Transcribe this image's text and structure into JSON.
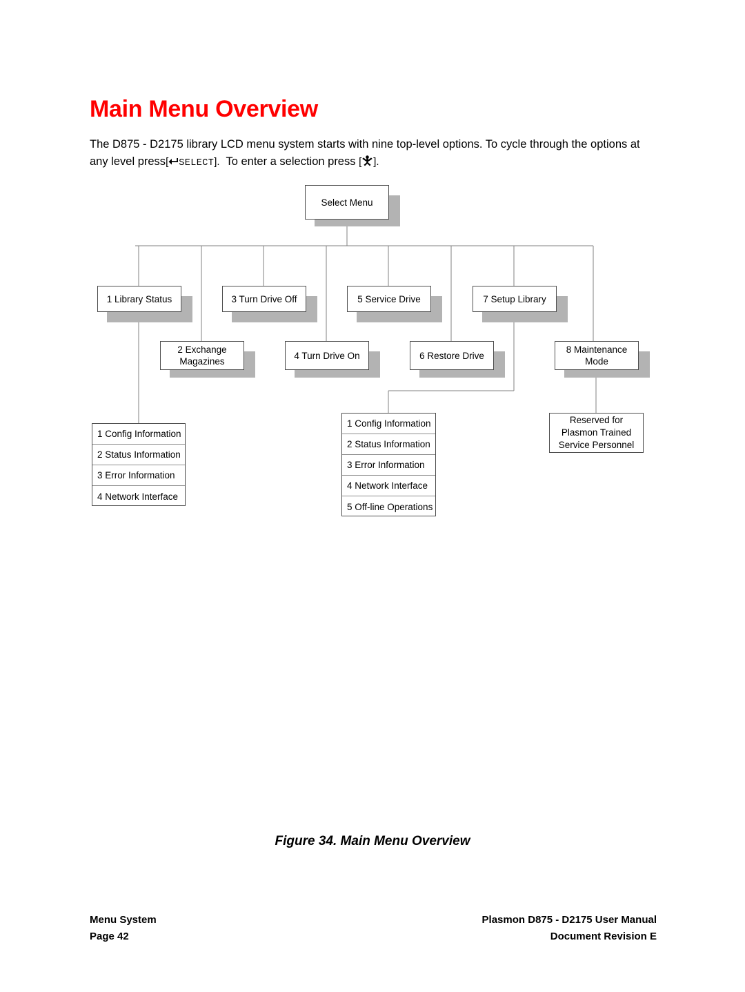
{
  "page": {
    "title": "Main Menu Overview",
    "title_color": "#ff0000",
    "intro_part_1": "The D875 - D2175 library LCD menu system starts with nine top-level options. To cycle through the options at any level press",
    "intro_bracket_open": "[",
    "intro_select_label": "SELECT",
    "intro_bracket_close": "].",
    "intro_part_2": "To enter a selection press",
    "intro_bracket_open_2": "[",
    "intro_bracket_close_2": "].",
    "icon_select_name": "select-arrow-icon",
    "icon_enter_name": "enter-person-icon"
  },
  "diagram": {
    "root": {
      "label": "Select Menu"
    },
    "row1": [
      {
        "label": "1 Library Status"
      },
      {
        "label": "3 Turn Drive Off"
      },
      {
        "label": "5 Service Drive"
      },
      {
        "label": "7 Setup Library"
      }
    ],
    "row2": [
      {
        "label": "2 Exchange\nMagazines",
        "line1": "2 Exchange",
        "line2": "Magazines"
      },
      {
        "label": "4 Turn Drive On"
      },
      {
        "label": "6 Restore Drive"
      },
      {
        "label": "8 Maintenance\nMode",
        "line1": "8 Maintenance",
        "line2": "Mode"
      }
    ],
    "library_status_submenu": {
      "items": [
        "1 Config Information",
        "2 Status Information",
        "3 Error Information",
        "4 Network Interface"
      ]
    },
    "setup_library_submenu": {
      "items": [
        "1 Config Information",
        "2 Status Information",
        "3 Error Information",
        "4 Network Interface",
        "5 Off-line Operations"
      ]
    },
    "maintenance_note": {
      "line1": "Reserved for",
      "line2": "Plasmon Trained",
      "line3": "Service Personnel"
    }
  },
  "caption": "Figure 34. Main Menu Overview",
  "footer": {
    "left_line_1": "Menu System",
    "left_line_2": "Page 42",
    "right_line_1": "Plasmon D875 - D2175 User Manual",
    "right_line_2": "Document Revision E"
  }
}
